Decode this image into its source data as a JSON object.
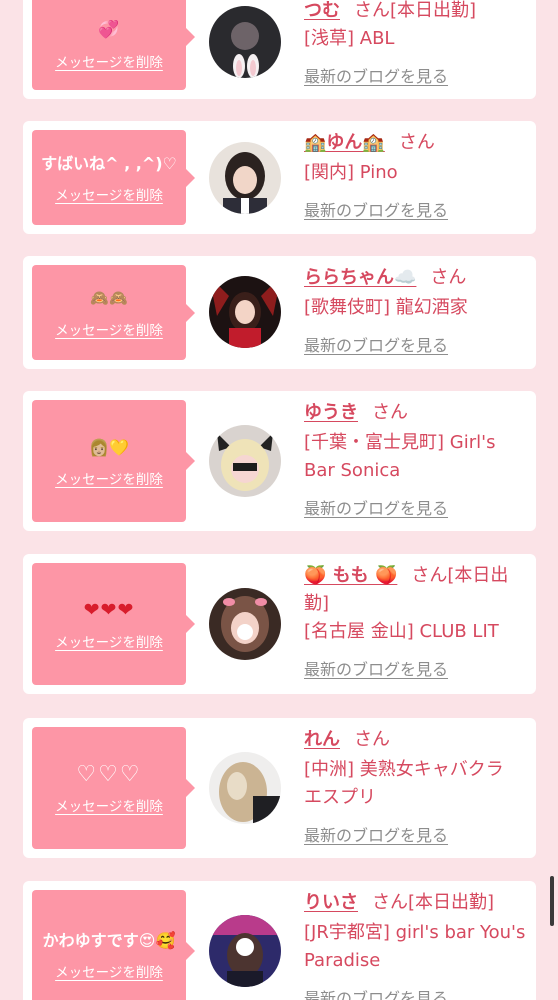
{
  "delete_label": "メッセージを削除",
  "blog_label": "最新のブログを見る",
  "honorific": "さん",
  "cards": [
    {
      "message": "💞",
      "name": "つむ",
      "status": "[本日出勤]",
      "shop": "[浅草] ABL"
    },
    {
      "message": "すばいね^ ,  ,^)♡",
      "name": "🏫ゆん🏫",
      "status": "",
      "shop": "[関内] Pino"
    },
    {
      "message": "🙈🙈",
      "name": "ららちゃん☁️",
      "status": "",
      "shop": "[歌舞伎町] 龍幻酒家"
    },
    {
      "message": "👩🏼💛",
      "name": "ゆうき",
      "status": "",
      "shop": "[千葉・富士見町] Girl's Bar Sonica"
    },
    {
      "message": "❤❤❤",
      "name": "🍑 もも 🍑",
      "status": "[本日出勤]",
      "shop": "[名古屋 金山] CLUB LIT"
    },
    {
      "message": "♡♡♡",
      "name": "れん",
      "status": "",
      "shop": "[中洲] 美熟女キャバクラ エスプリ"
    },
    {
      "message": "かわゆすです😍🥰",
      "name": "りいさ",
      "status": "[本日出勤]",
      "shop": "[JR宇都宮] girl's bar You's Paradise"
    }
  ]
}
